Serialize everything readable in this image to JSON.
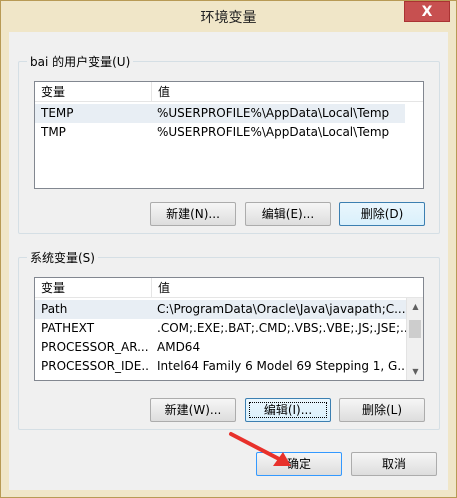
{
  "window": {
    "title": "环境变量",
    "close_glyph": "X"
  },
  "user_vars": {
    "legend": "bai 的用户变量(U)",
    "columns": [
      "变量",
      "值"
    ],
    "rows": [
      {
        "name": "TEMP",
        "value": "%USERPROFILE%\\AppData\\Local\\Temp",
        "selected": true
      },
      {
        "name": "TMP",
        "value": "%USERPROFILE%\\AppData\\Local\\Temp",
        "selected": false
      }
    ],
    "buttons": {
      "new": "新建(N)...",
      "edit": "编辑(E)...",
      "delete": "删除(D)"
    }
  },
  "system_vars": {
    "legend": "系统变量(S)",
    "columns": [
      "变量",
      "值"
    ],
    "rows": [
      {
        "name": "Path",
        "value": "C:\\ProgramData\\Oracle\\Java\\javapath;C...",
        "selected": true
      },
      {
        "name": "PATHEXT",
        "value": ".COM;.EXE;.BAT;.CMD;.VBS;.VBE;.JS;.JSE;...",
        "selected": false
      },
      {
        "name": "PROCESSOR_AR...",
        "value": "AMD64",
        "selected": false
      },
      {
        "name": "PROCESSOR_IDE...",
        "value": "Intel64 Family 6 Model 69 Stepping 1, G...",
        "selected": false
      }
    ],
    "buttons": {
      "new": "新建(W)...",
      "edit": "编辑(I)...",
      "delete": "删除(L)"
    }
  },
  "dialog_buttons": {
    "ok": "确定",
    "cancel": "取消"
  },
  "colors": {
    "annotation_arrow": "#e8312b"
  }
}
